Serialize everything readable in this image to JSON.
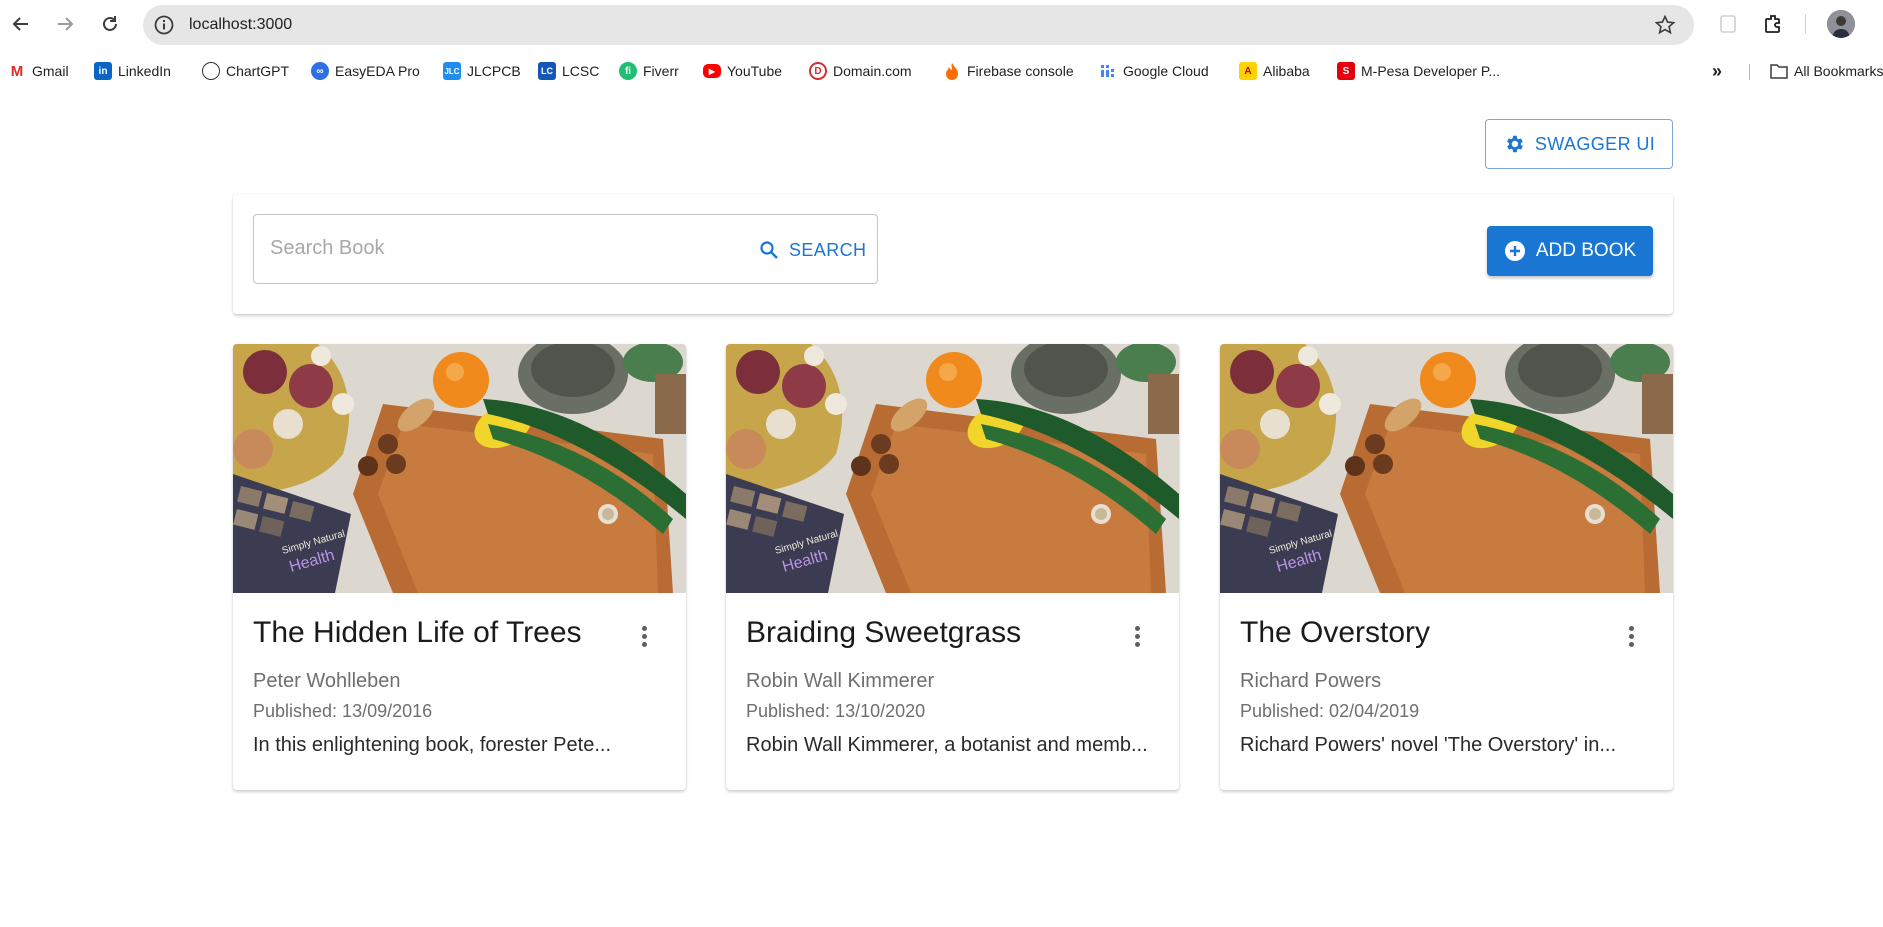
{
  "browser": {
    "url": "localhost:3000",
    "bookmarks": [
      {
        "label": "Gmail",
        "icon": "gmail-icon"
      },
      {
        "label": "LinkedIn",
        "icon": "linkedin-icon"
      },
      {
        "label": "ChartGPT",
        "icon": "chatgpt-icon"
      },
      {
        "label": "EasyEDA Pro",
        "icon": "easyeda-icon"
      },
      {
        "label": "JLCPCB",
        "icon": "jlcpcb-icon"
      },
      {
        "label": "LCSC",
        "icon": "lcsc-icon"
      },
      {
        "label": "Fiverr",
        "icon": "fiverr-icon"
      },
      {
        "label": "YouTube",
        "icon": "youtube-icon"
      },
      {
        "label": "Domain.com",
        "icon": "domain-icon"
      },
      {
        "label": "Firebase console",
        "icon": "firebase-icon"
      },
      {
        "label": "Google Cloud",
        "icon": "google-cloud-icon"
      },
      {
        "label": "Alibaba",
        "icon": "alibaba-icon"
      },
      {
        "label": "M-Pesa Developer P...",
        "icon": "mpesa-icon"
      }
    ],
    "overflow_label": "»",
    "all_bookmarks_label": "All Bookmarks"
  },
  "app": {
    "swagger_label": "SWAGGER UI",
    "search": {
      "placeholder": "Search Book",
      "value": "",
      "button_label": "SEARCH"
    },
    "add_book_label": "ADD BOOK",
    "books": [
      {
        "title": "The Hidden Life of Trees",
        "author": "Peter Wohlleben",
        "published": "Published: 13/09/2016",
        "description": "In this enlightening book, forester Pete..."
      },
      {
        "title": "Braiding Sweetgrass",
        "author": "Robin Wall Kimmerer",
        "published": "Published: 13/10/2020",
        "description": "Robin Wall Kimmerer, a botanist and memb..."
      },
      {
        "title": "The Overstory",
        "author": "Richard Powers",
        "published": "Published: 02/04/2019",
        "description": "Richard Powers' novel 'The Overstory' in..."
      }
    ],
    "cover_image": {
      "book_text_line1": "Simply Natural",
      "book_text_line2": "Health"
    }
  },
  "colors": {
    "primary": "#1976d2",
    "omnibox": "#e6e6e6"
  }
}
